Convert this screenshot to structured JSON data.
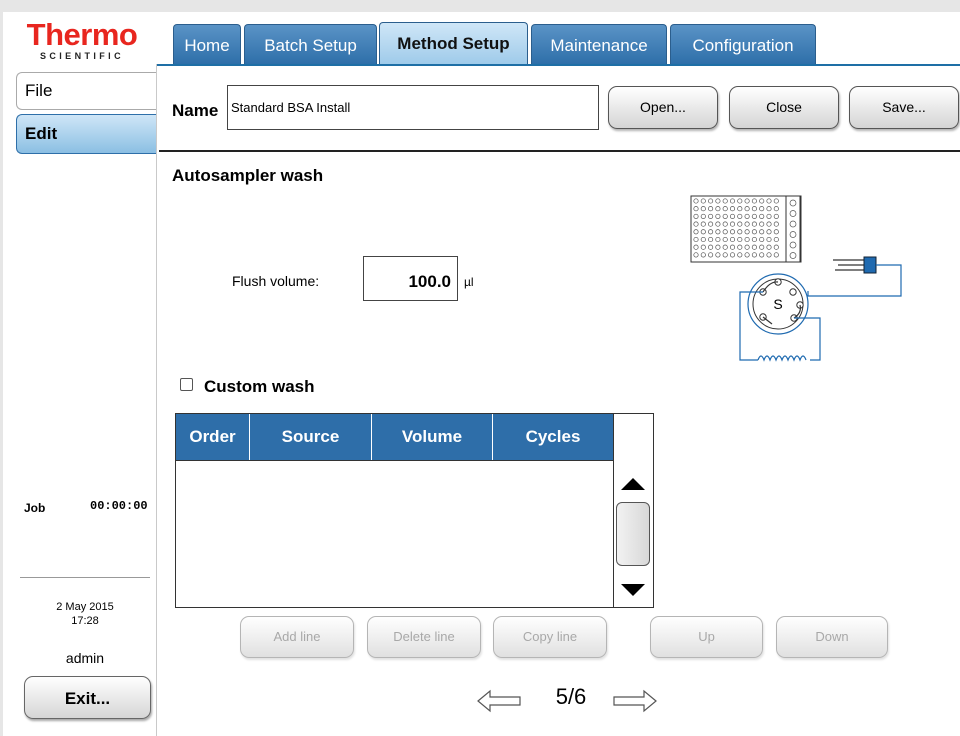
{
  "brand": {
    "name": "Thermo",
    "sub": "SCIENTIFIC"
  },
  "tabs": [
    {
      "label": "Home",
      "active": false
    },
    {
      "label": "Batch Setup",
      "active": false
    },
    {
      "label": "Method Setup",
      "active": true
    },
    {
      "label": "Maintenance",
      "active": false
    },
    {
      "label": "Configuration",
      "active": false
    }
  ],
  "menu": {
    "file": "File",
    "edit": "Edit"
  },
  "status": {
    "job_label": "Job",
    "job_time": "00:00:00",
    "date": "2 May 2015",
    "time": "17:28",
    "user": "admin",
    "exit_label": "Exit..."
  },
  "method": {
    "name_label": "Name",
    "name_value": "Standard BSA Install",
    "open_label": "Open...",
    "close_label": "Close",
    "save_label": "Save..."
  },
  "section": {
    "title": "Autosampler wash",
    "valve_label": "S"
  },
  "flush": {
    "label": "Flush volume:",
    "value": "100.0",
    "unit": "µl"
  },
  "custom_wash": {
    "label": "Custom wash",
    "checked": false
  },
  "table": {
    "columns": [
      "Order",
      "Source",
      "Volume",
      "Cycles"
    ],
    "rows": []
  },
  "actions": {
    "add": "Add line",
    "delete": "Delete line",
    "copy": "Copy line",
    "up": "Up",
    "down": "Down"
  },
  "pager": {
    "page": "5/6"
  },
  "colors": {
    "tab": "#2e6fa9",
    "tab_active": "#a9d2ee",
    "header": "#2e6ea9",
    "brand": "#e8261f"
  }
}
